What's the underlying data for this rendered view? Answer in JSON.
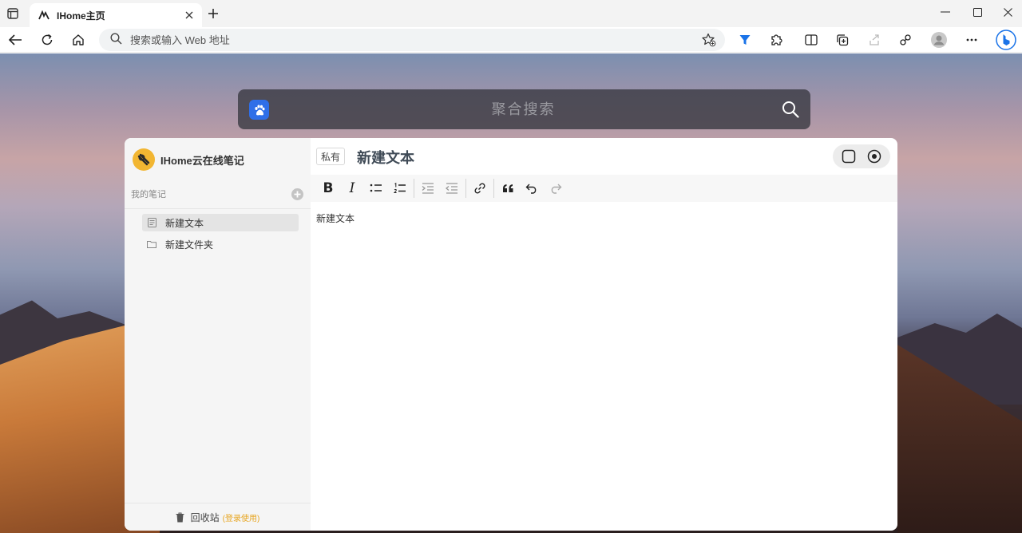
{
  "browser": {
    "tab": {
      "title": "IHome主页"
    },
    "address": {
      "placeholder": "搜索或输入 Web 地址"
    }
  },
  "search": {
    "placeholder": "聚合搜索",
    "engine_icon": "baidu-paw-icon"
  },
  "notes": {
    "brand": "IHome云在线笔记",
    "section_title": "我的笔记",
    "items": [
      {
        "label": "新建文本",
        "icon": "document-icon",
        "active": true
      },
      {
        "label": "新建文件夹",
        "icon": "folder-icon",
        "active": false
      }
    ],
    "trash_label": "回收站",
    "login_hint": "(登录使用)"
  },
  "editor": {
    "privacy_badge": "私有",
    "doc_title": "新建文本",
    "body_text": "新建文本",
    "toolbar": {
      "bold": "B",
      "italic": "I"
    }
  },
  "colors": {
    "accent_blue": "#1a73e8",
    "baidu_blue": "#2f6fe8",
    "brand_yellow": "#f2b632",
    "hint_orange": "#e7a520"
  }
}
